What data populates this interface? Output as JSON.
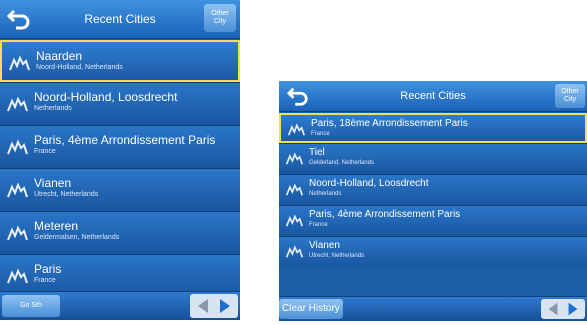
{
  "left": {
    "title": "Recent Cities",
    "other_city": [
      "Other",
      "City"
    ],
    "items": [
      {
        "name": "Naarden",
        "sub": "Noord-Holland, Netherlands",
        "selected": true
      },
      {
        "name": "Noord-Holland, Loosdrecht",
        "sub": "Netherlands",
        "selected": false
      },
      {
        "name": "Paris, 4ème Arrondissement Paris",
        "sub": "France",
        "selected": false
      },
      {
        "name": "Vianen",
        "sub": "Utrecht, Netherlands",
        "selected": false
      },
      {
        "name": "Meteren",
        "sub": "Geldermalsen, Netherlands",
        "selected": false
      },
      {
        "name": "Paris",
        "sub": "France",
        "selected": false
      }
    ],
    "footer_button": "Go Sth"
  },
  "right": {
    "title": "Recent Cities",
    "other_city": [
      "Other",
      "City"
    ],
    "items": [
      {
        "name": "Paris, 18ème Arrondissement Paris",
        "sub": "France",
        "selected": true
      },
      {
        "name": "Tiel",
        "sub": "Gelderland, Netherlands",
        "selected": false
      },
      {
        "name": "Noord-Holland, Loosdrecht",
        "sub": "Netherlands",
        "selected": false
      },
      {
        "name": "Paris, 4ème Arrondissement Paris",
        "sub": "France",
        "selected": false
      },
      {
        "name": "Vianen",
        "sub": "Utrecht, Netherlands",
        "selected": false
      }
    ],
    "footer_button": "Clear History"
  },
  "icons": {
    "back": "back-arrow-icon",
    "city": "city-icon",
    "prev": "left-arrow-icon",
    "next": "right-arrow-icon"
  },
  "colors": {
    "panel": "#1d5fa6",
    "selection": "#f2e24a",
    "header": "#3f92e0"
  }
}
